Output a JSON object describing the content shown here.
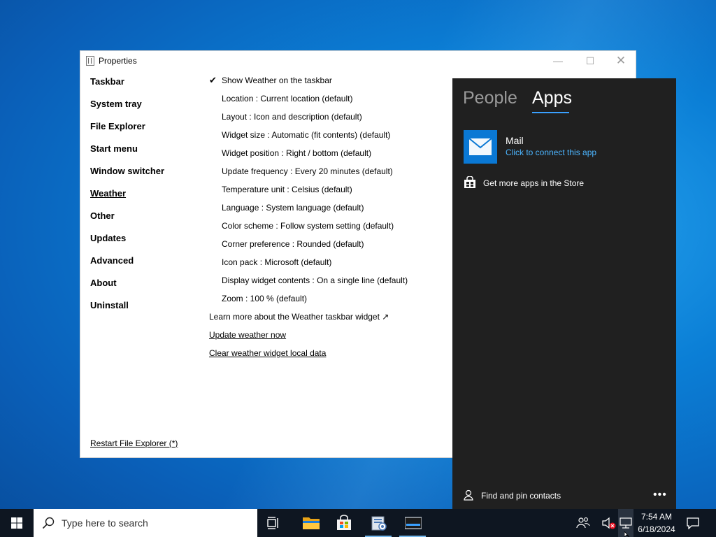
{
  "window": {
    "title": "Properties",
    "minimize": "—",
    "maximize": "☐",
    "close": "✕"
  },
  "nav": {
    "items": [
      {
        "label": "Taskbar"
      },
      {
        "label": "System tray"
      },
      {
        "label": "File Explorer"
      },
      {
        "label": "Start menu"
      },
      {
        "label": "Window switcher"
      },
      {
        "label": "Weather",
        "active": true
      },
      {
        "label": "Other"
      },
      {
        "label": "Updates"
      },
      {
        "label": "Advanced"
      },
      {
        "label": "About"
      },
      {
        "label": "Uninstall"
      }
    ],
    "restart": "Restart File Explorer (*)"
  },
  "settings": {
    "check_mark": "✔",
    "items": [
      "Show Weather on the taskbar",
      "Location : Current location (default)",
      "Layout : Icon and description (default)",
      "Widget size : Automatic (fit contents) (default)",
      "Widget position : Right / bottom (default)",
      "Update frequency : Every 20 minutes (default)",
      "Temperature unit : Celsius (default)",
      "Language : System language (default)",
      "Color scheme : Follow system setting (default)",
      "Corner preference : Rounded (default)",
      "Icon pack : Microsoft (default)",
      "Display widget contents : On a single line (default)",
      "Zoom : 100 % (default)"
    ],
    "learn_more": "Learn more about the Weather taskbar widget ↗",
    "update_now": "Update weather now",
    "clear_data": "Clear weather widget local data"
  },
  "flyout": {
    "tab_people": "People",
    "tab_apps": "Apps",
    "mail_name": "Mail",
    "mail_connect": "Click to connect this app",
    "store_text": "Get more apps in the Store",
    "find_text": "Find and pin contacts",
    "more": "•••",
    "accent_color": "#3aa0ff",
    "link_color": "#4cb5ff"
  },
  "taskbar": {
    "search_placeholder": "Type here to search",
    "time": "7:54 AM",
    "date": "6/18/2024",
    "background": "#0e1621"
  }
}
